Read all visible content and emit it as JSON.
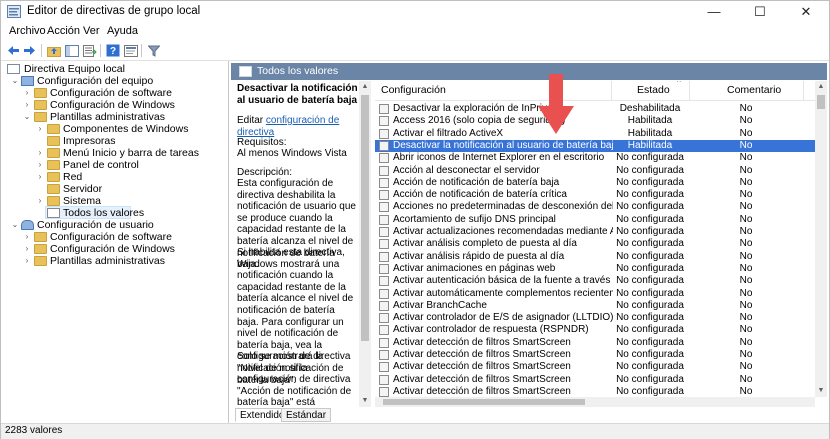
{
  "window": {
    "title": "Editor de directivas de grupo local",
    "controls": {
      "minimize": "—",
      "maximize": "☐",
      "close": "✕"
    }
  },
  "menu": [
    "Archivo",
    "Acción",
    "Ver",
    "Ayuda"
  ],
  "toolbar": {
    "icons": [
      "back-icon",
      "forward-icon",
      "folder-up-icon",
      "show-hide-tree-icon",
      "export-list-icon",
      "help-icon",
      "properties-icon",
      "filter-icon"
    ]
  },
  "tree": {
    "root": "Directiva Equipo local",
    "items": [
      {
        "label": "Configuración del equipo",
        "expander": "⌄",
        "icon": "computer-icon"
      },
      {
        "label": "Configuración de software",
        "expander": "›",
        "icon": "folder-icon"
      },
      {
        "label": "Configuración de Windows",
        "expander": "›",
        "icon": "folder-icon"
      },
      {
        "label": "Plantillas administrativas",
        "expander": "⌄",
        "icon": "folder-icon"
      },
      {
        "label": "Componentes de Windows",
        "expander": "›",
        "icon": "folder-icon"
      },
      {
        "label": "Impresoras",
        "expander": "",
        "icon": "folder-icon"
      },
      {
        "label": "Menú Inicio y barra de tareas",
        "expander": "›",
        "icon": "folder-icon"
      },
      {
        "label": "Panel de control",
        "expander": "›",
        "icon": "folder-icon"
      },
      {
        "label": "Red",
        "expander": "›",
        "icon": "folder-icon"
      },
      {
        "label": "Servidor",
        "expander": "",
        "icon": "folder-icon"
      },
      {
        "label": "Sistema",
        "expander": "›",
        "icon": "folder-icon"
      },
      {
        "label": "Todos los valores",
        "expander": "",
        "icon": "settings-list-icon",
        "selected": true
      },
      {
        "label": "Configuración de usuario",
        "expander": "⌄",
        "icon": "user-icon"
      },
      {
        "label": "Configuración de software",
        "expander": "›",
        "icon": "folder-icon"
      },
      {
        "label": "Configuración de Windows",
        "expander": "›",
        "icon": "folder-icon"
      },
      {
        "label": "Plantillas administrativas",
        "expander": "›",
        "icon": "folder-icon"
      }
    ]
  },
  "panel_header": "Todos los valores",
  "description": {
    "title": "Desactivar la notificación al usuario de batería baja",
    "edit_prefix": "Editar",
    "edit_link": "configuración de directiva",
    "requirements_label": "Requisitos:",
    "requirements_value": "Al menos Windows Vista",
    "desc_label": "Descripción:",
    "paragraphs": [
      "Esta configuración de directiva deshabilita la notificación de usuario que se produce cuando la capacidad restante de la batería alcanza el nivel de notificación de batería baja.",
      "Si habilita esta directiva, Windows mostrará una notificación cuando la capacidad restante de la batería alcance el nivel de notificación de batería baja. Para configurar un nivel de notificación de batería baja, vea la configuración de directiva \"Nivel de notificación de batería baja\".",
      "Solo se mostrará la notificación si la configuración de directiva \"Acción de notificación de batería baja\" está configurada como \"No se requiere acción\"."
    ]
  },
  "list": {
    "columns": {
      "setting": "Configuración",
      "state": "Estado",
      "comment": "Comentario",
      "sort_indicator": "^"
    },
    "rows": [
      {
        "name": "Desactivar la exploración de InPrivate",
        "state": "Deshabilitada",
        "comment": "No"
      },
      {
        "name": "Access 2016 (solo copia de seguridad)",
        "state": "Habilitada",
        "comment": "No"
      },
      {
        "name": "Activar el filtrado ActiveX",
        "state": "Habilitada",
        "comment": "No"
      },
      {
        "name": "Desactivar la notificación al usuario de batería baja",
        "state": "Habilitada",
        "comment": "No",
        "selected": true
      },
      {
        "name": "Abrir iconos de Internet Explorer en el escritorio",
        "state": "No configurada",
        "comment": "No"
      },
      {
        "name": "Acción al desconectar el servidor",
        "state": "No configurada",
        "comment": "No"
      },
      {
        "name": "Acción de notificación de batería baja",
        "state": "No configurada",
        "comment": "No"
      },
      {
        "name": "Acción de notificación de batería crítica",
        "state": "No configurada",
        "comment": "No"
      },
      {
        "name": "Acciones no predeterminadas de desconexión del servidor",
        "state": "No configurada",
        "comment": "No"
      },
      {
        "name": "Acortamiento de sufijo DNS principal",
        "state": "No configurada",
        "comment": "No"
      },
      {
        "name": "Activar actualizaciones recomendadas mediante Actualizació...",
        "state": "No configurada",
        "comment": "No"
      },
      {
        "name": "Activar análisis completo de puesta al día",
        "state": "No configurada",
        "comment": "No"
      },
      {
        "name": "Activar análisis rápido de puesta al día",
        "state": "No configurada",
        "comment": "No"
      },
      {
        "name": "Activar animaciones en páginas web",
        "state": "No configurada",
        "comment": "No"
      },
      {
        "name": "Activar autenticación básica de la fuente a través de HTTP",
        "state": "No configurada",
        "comment": "No"
      },
      {
        "name": "Activar automáticamente complementos recientemente ins...",
        "state": "No configurada",
        "comment": "No"
      },
      {
        "name": "Activar BranchCache",
        "state": "No configurada",
        "comment": "No"
      },
      {
        "name": "Activar controlador de E/S de asignador (LLTDIO)",
        "state": "No configurada",
        "comment": "No"
      },
      {
        "name": "Activar controlador de respuesta (RSPNDR)",
        "state": "No configurada",
        "comment": "No"
      },
      {
        "name": "Activar detección de filtros SmartScreen",
        "state": "No configurada",
        "comment": "No"
      },
      {
        "name": "Activar detección de filtros SmartScreen",
        "state": "No configurada",
        "comment": "No"
      },
      {
        "name": "Activar detección de filtros SmartScreen",
        "state": "No configurada",
        "comment": "No"
      },
      {
        "name": "Activar detección de filtros SmartScreen",
        "state": "No configurada",
        "comment": "No"
      },
      {
        "name": "Activar detección de filtros SmartScreen",
        "state": "No configurada",
        "comment": "No"
      }
    ]
  },
  "tabs": [
    "Extendido",
    "Estándar"
  ],
  "status": "2283 valores",
  "colors": {
    "header_blue": "#6b85a7",
    "selection_blue": "#3874d8",
    "annotation_red": "#e8514f"
  }
}
